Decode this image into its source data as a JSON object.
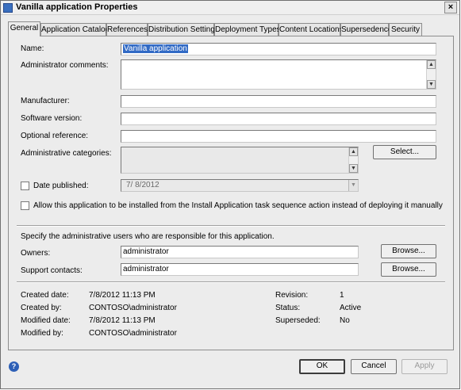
{
  "window": {
    "title": "Vanilla application Properties",
    "close_glyph": "×",
    "icon": "app-window-icon"
  },
  "tabs": [
    {
      "label": "General"
    },
    {
      "label": "Application Catalog"
    },
    {
      "label": "References"
    },
    {
      "label": "Distribution Settings"
    },
    {
      "label": "Deployment Types"
    },
    {
      "label": "Content Locations"
    },
    {
      "label": "Supersedence"
    },
    {
      "label": "Security"
    }
  ],
  "general": {
    "name_label": "Name:",
    "name_value": "Vanilla application",
    "admin_comments_label": "Administrator comments:",
    "admin_comments_value": "",
    "manufacturer_label": "Manufacturer:",
    "manufacturer_value": "",
    "software_version_label": "Software version:",
    "software_version_value": "",
    "optional_reference_label": "Optional reference:",
    "optional_reference_value": "",
    "admin_categories_label": "Administrative categories:",
    "select_button": "Select...",
    "date_published_label": "Date published:",
    "date_published_value": "7/ 8/2012",
    "allow_task_sequence_label": "Allow this application to be installed from the Install Application task sequence action instead of deploying it manually",
    "admin_users_text": "Specify the administrative users who are responsible for this application.",
    "owners_label": "Owners:",
    "owners_value": "administrator",
    "support_contacts_label": "Support contacts:",
    "support_contacts_value": "administrator",
    "browse_button": "Browse..."
  },
  "info": {
    "created_date_label": "Created date:",
    "created_date_value": "7/8/2012 11:13 PM",
    "created_by_label": "Created by:",
    "created_by_value": "CONTOSO\\administrator",
    "modified_date_label": "Modified date:",
    "modified_date_value": "7/8/2012 11:13 PM",
    "modified_by_label": "Modified by:",
    "modified_by_value": "CONTOSO\\administrator",
    "revision_label": "Revision:",
    "revision_value": "1",
    "status_label": "Status:",
    "status_value": "Active",
    "superseded_label": "Superseded:",
    "superseded_value": "No"
  },
  "footer": {
    "ok": "OK",
    "cancel": "Cancel",
    "apply": "Apply",
    "help_glyph": "?"
  },
  "glyphs": {
    "up": "▲",
    "down": "▼"
  }
}
